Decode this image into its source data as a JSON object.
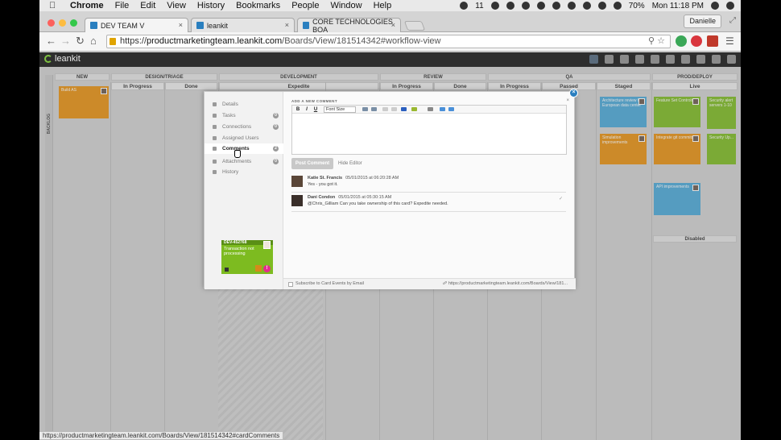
{
  "menubar": {
    "app": "Chrome",
    "items": [
      "File",
      "Edit",
      "View",
      "History",
      "Bookmarks",
      "People",
      "Window",
      "Help"
    ],
    "badge": "11",
    "battery": "70%",
    "clock": "Mon 11:18 PM"
  },
  "tabs": [
    {
      "label": "DEV TEAM V"
    },
    {
      "label": "leankit"
    },
    {
      "label": "CORE TECHNOLOGIES BOA"
    }
  ],
  "profile_name": "Danielle",
  "omnibox": {
    "scheme": "https://",
    "host": "productmarketingteam.leankit.com",
    "path": "/Boards/View/181514342#workflow-view"
  },
  "app_brand": "leankit",
  "lanes": {
    "top": [
      {
        "label": "NEW"
      },
      {
        "label": "DESIGN/TRIAGE"
      },
      {
        "label": "DEVELOPMENT"
      },
      {
        "label": "REVIEW"
      },
      {
        "label": "QA"
      },
      {
        "label": "PROD/DEPLOY"
      }
    ],
    "sub": [
      {
        "label": "In Progress"
      },
      {
        "label": "Done"
      },
      {
        "label": "Expedite"
      },
      {
        "label": "In Progress"
      },
      {
        "label": "Done"
      },
      {
        "label": "In Progress"
      },
      {
        "label": "Passed"
      },
      {
        "label": "Staged"
      },
      {
        "label": "Live"
      }
    ],
    "backlog": "BACKLOG",
    "disabled": "Disabled"
  },
  "board_cards": [
    {
      "text": "Build AS"
    },
    {
      "text": "Architecture review for European data center"
    },
    {
      "text": "Feature Set Controls"
    },
    {
      "text": "Security alert servers 1-10"
    },
    {
      "text": "Simulation improvements"
    },
    {
      "text": "Integrate git commits"
    },
    {
      "text": "Security Up..."
    },
    {
      "text": "API improvements"
    }
  ],
  "modal": {
    "sidebar": [
      {
        "label": "Details",
        "count": ""
      },
      {
        "label": "Tasks",
        "count": "0"
      },
      {
        "label": "Connections",
        "count": "0"
      },
      {
        "label": "Assigned Users",
        "count": ""
      },
      {
        "label": "Comments",
        "count": "2"
      },
      {
        "label": "Attachments",
        "count": "0"
      },
      {
        "label": "History",
        "count": ""
      }
    ],
    "card": {
      "id": "DEV-452768",
      "title": "Transaction not processing",
      "badge": "!"
    },
    "add_comment_title": "ADD A NEW COMMENT",
    "toolbar": {
      "bold": "B",
      "italic": "I",
      "underline": "U",
      "font_size": "Font Size"
    },
    "post_button": "Post Comment",
    "hide_editor": "Hide Editor",
    "comments": [
      {
        "author": "Katie St. Francis",
        "date": "05/01/2015 at 06:20:28 AM",
        "text": "Yes - you got it."
      },
      {
        "author": "Dani Condon",
        "date": "05/01/2015 at 05:30:15 AM",
        "text": "@Chris_Gilliam Can you take ownership of this card?  Expedite needed."
      }
    ],
    "subscribe_label": "Subscribe to Card Events by Email",
    "card_link": "https://productmarketingteam.leankit.com/Boards/View/181..."
  },
  "statusbar": "https://productmarketingteam.leankit.com/Boards/View/181514342#cardComments",
  "colors": {
    "orange": "#e8900f",
    "blue": "#4aa8d8",
    "green": "#7dbb20",
    "pink": "#e52b8e",
    "accent": "#2b7fbf"
  }
}
